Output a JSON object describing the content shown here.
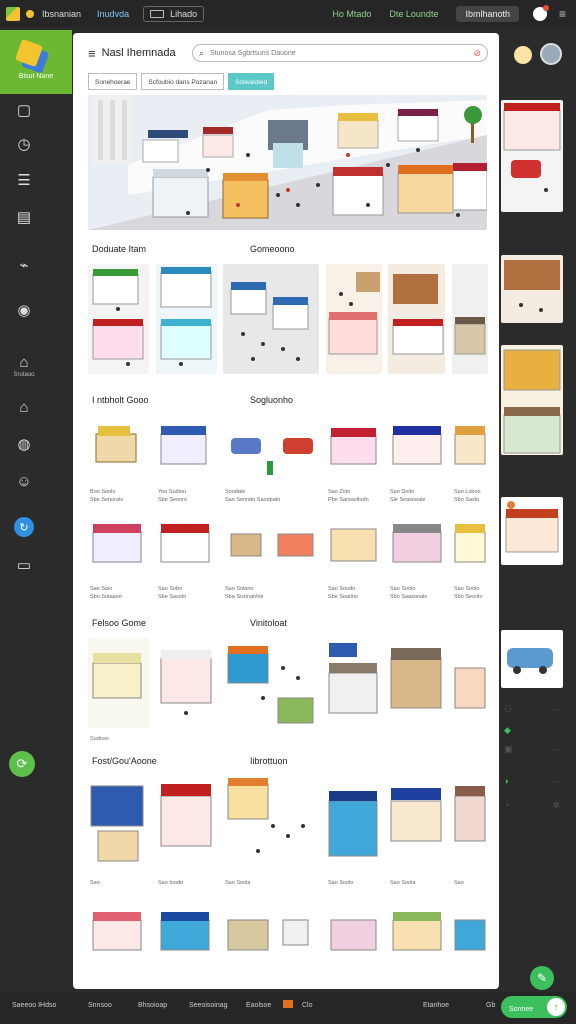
{
  "topbar": {
    "app_title": "Ibsnanian",
    "nav_link": "Inudvda",
    "box_label": "Lihado",
    "status_text": "Ho Mtado",
    "status_text2": "Dte Loundte",
    "pill_label": "Ibmlhanoth"
  },
  "sidebar": {
    "brand_name": "Bisut Nane",
    "label_1": "Srutaoo",
    "items": [
      "note-icon",
      "clock-icon",
      "layers-icon",
      "book-icon",
      "chart-icon",
      "badge-icon",
      "home-icon",
      "house-icon",
      "globe-icon",
      "panda-icon",
      "share-icon",
      "folder-icon",
      "add-icon"
    ]
  },
  "header": {
    "title": "Nasl Ihemnada",
    "search_placeholder": "Stunosa Sgbrtsuns Dauone"
  },
  "tabs": [
    {
      "label": "Sonehoerae"
    },
    {
      "label": "Scfoubio dans Pozanan"
    },
    {
      "label": "Sotwasbed"
    }
  ],
  "sections": {
    "s1_left": "Doduate Itam",
    "s1_right": "Gomeoono",
    "s2_left": "I ntbholt Gooo",
    "s2_right": "Sogluonho",
    "s3_left": "Felsoo Gome",
    "s3_right": "Vinitoloat",
    "s4_left": "Fost/Gou'Aoone",
    "s4_right": "Iibrottuon"
  },
  "captions": {
    "r2a": [
      "Boo Soolo",
      "Sbe Senorals"
    ],
    "r2b": [
      "Yoo Sudiou",
      "Sbe Seooro"
    ],
    "r2c": [
      "Soodaie",
      "Sao Senndo Saodpato"
    ],
    "r2d": [
      "Sao Zoio",
      "Pbe Sarsaoltodn"
    ],
    "r2e": [
      "Sao Doito",
      "Sle Seasoeale"
    ],
    "r2f": [
      "Sao Loboo",
      "Sbo Saslo"
    ],
    "r3a": [
      "Sae Soio",
      "Sbo Sotaano"
    ],
    "r3b": [
      "Sao Sobo",
      "Sbe Sasolo"
    ],
    "r3c": [
      "Sao Solano",
      "Sba Sozinahhle"
    ],
    "r3d": [
      "Sao Soodo",
      "Sbe Seatino"
    ],
    "r3e": [
      "Sao Soolo",
      "Sbo Saasonals"
    ],
    "r3f": [
      "Sao Soolo",
      "Sbo Seoolo"
    ],
    "r4a": [
      "Sudoso"
    ],
    "r5a": [
      "Sao"
    ],
    "r5b": [
      "Sao Ioodo"
    ],
    "r5c": [
      "Sao Soola"
    ],
    "r5d": [
      "Sao Soolo"
    ],
    "r5e": [
      "Sao Soola"
    ],
    "r5f": [
      "Sao"
    ]
  },
  "bottombar": {
    "items": [
      "Saeeoo IHdso",
      "Snnsoo",
      "Bhsoioap",
      "Seeoisoinag",
      "Eaolsoe",
      "Clo",
      "Etanhoe",
      "Gb"
    ],
    "cta_label": "Sonnee"
  },
  "colors": {
    "accent_green": "#6cb833",
    "tab_active": "#5cc8c8",
    "cta_green": "#3cbf5c",
    "sidebar_active": "#2f8fe0"
  }
}
